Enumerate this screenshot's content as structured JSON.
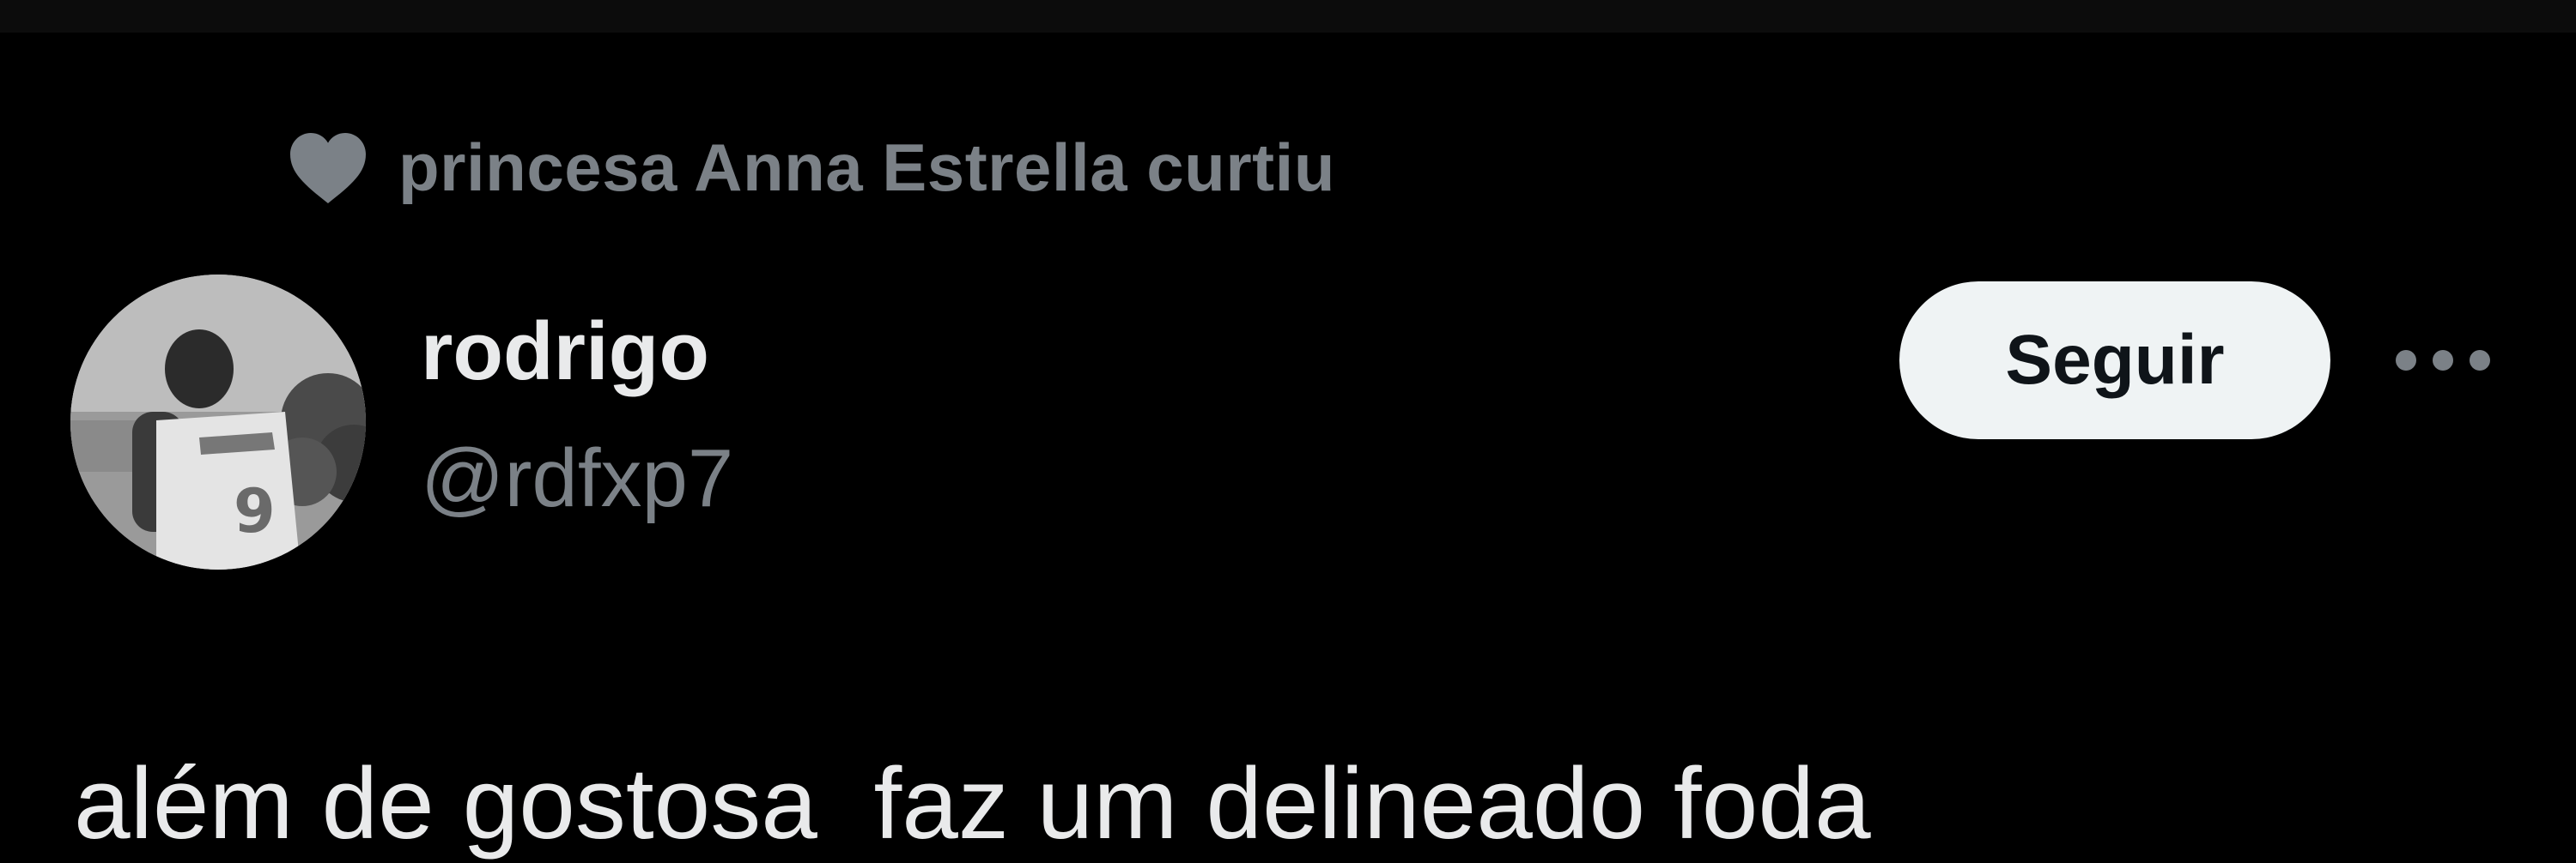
{
  "social_context": {
    "icon": "heart-icon",
    "text": "princesa Anna Estrella curtiu"
  },
  "user": {
    "avatar": "avatar",
    "name": "rodrigo",
    "handle": "@rdfxp7"
  },
  "actions": {
    "follow_label": "Seguir",
    "more_icon": "more-options-icon"
  },
  "tweet": {
    "text": "além de gostosa  faz um delineado foda"
  },
  "colors": {
    "background": "#000000",
    "primary_text": "#e9eaeb",
    "secondary_text": "#7b8187",
    "button_background": "#eff3f4",
    "button_text": "#0f1419"
  }
}
